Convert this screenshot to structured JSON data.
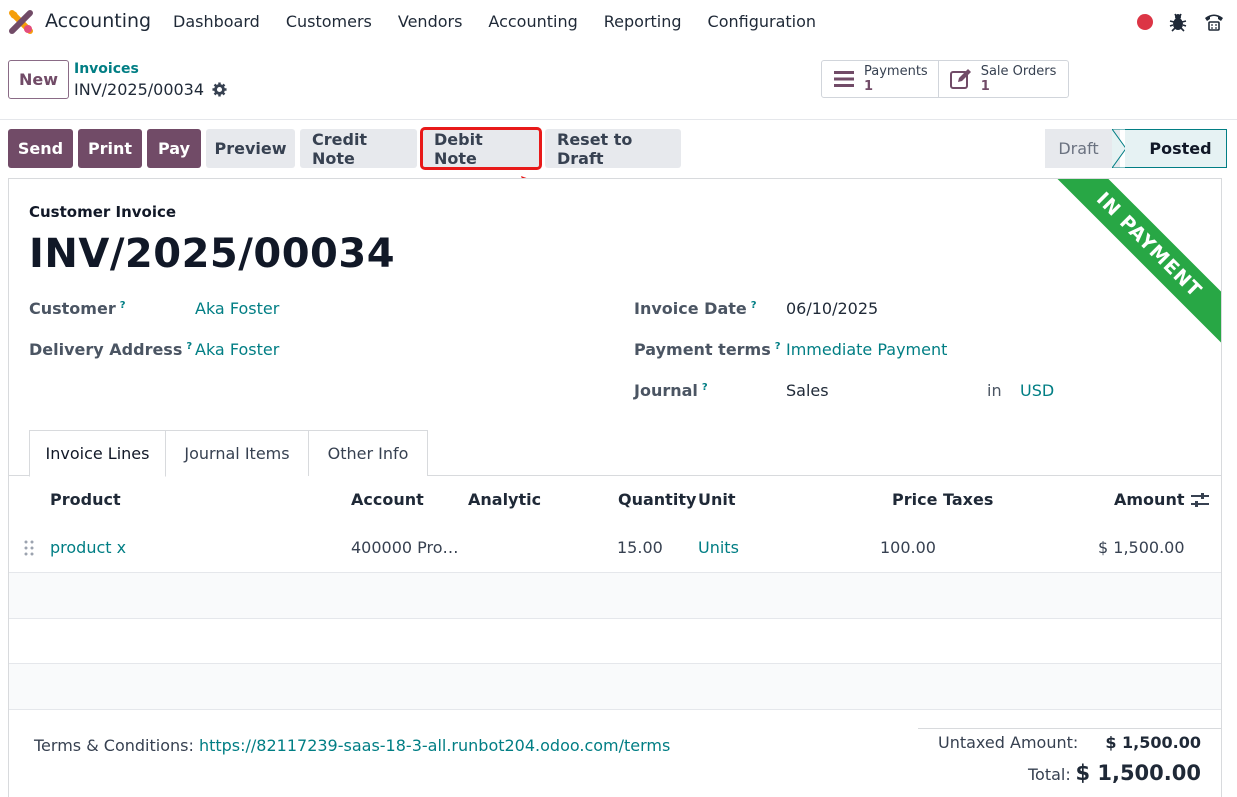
{
  "app": {
    "name": "Accounting"
  },
  "menu": [
    "Dashboard",
    "Customers",
    "Vendors",
    "Accounting",
    "Reporting",
    "Configuration"
  ],
  "control": {
    "new_label": "New",
    "breadcrumb_parent": "Invoices",
    "breadcrumb_current": "INV/2025/00034"
  },
  "smart_buttons": {
    "payments": {
      "label": "Payments",
      "count": "1"
    },
    "sale_orders": {
      "label": "Sale Orders",
      "count": "1"
    }
  },
  "actions": {
    "send": "Send",
    "print": "Print",
    "pay": "Pay",
    "preview": "Preview",
    "credit_note": "Credit Note",
    "debit_note": "Debit Note",
    "reset_draft": "Reset to Draft"
  },
  "status": {
    "draft": "Draft",
    "posted": "Posted",
    "active": "Posted"
  },
  "ribbon": "IN PAYMENT",
  "doc": {
    "type": "Customer Invoice",
    "number": "INV/2025/00034",
    "customer_label": "Customer",
    "customer": "Aka Foster",
    "delivery_label": "Delivery Address",
    "delivery": "Aka Foster",
    "invoice_date_label": "Invoice Date",
    "invoice_date": "06/10/2025",
    "payment_terms_label": "Payment terms",
    "payment_terms": "Immediate Payment",
    "journal_label": "Journal",
    "journal": "Sales",
    "in_label": "in",
    "currency": "USD",
    "help_mark": "?"
  },
  "tabs": [
    "Invoice Lines",
    "Journal Items",
    "Other Info"
  ],
  "table": {
    "headers": [
      "Product",
      "Account",
      "Analytic",
      "Quantity",
      "Unit",
      "Price",
      "Taxes",
      "Amount"
    ],
    "rows": [
      {
        "product": "product x",
        "account": "400000 Pro…",
        "analytic": "",
        "quantity": "15.00",
        "unit": "Units",
        "price": "100.00",
        "taxes": "",
        "amount": "$ 1,500.00"
      }
    ]
  },
  "footer": {
    "terms_label": "Terms & Conditions:",
    "terms_url": "https://82117239-saas-18-3-all.runbot204.odoo.com/terms",
    "untaxed_label": "Untaxed Amount:",
    "untaxed": "$ 1,500.00",
    "total_label": "Total:",
    "total": "$ 1,500.00"
  },
  "colors": {
    "primary": "#714b67",
    "link": "#017e84",
    "ribbon": "#28a745",
    "highlight": "#e81919"
  }
}
